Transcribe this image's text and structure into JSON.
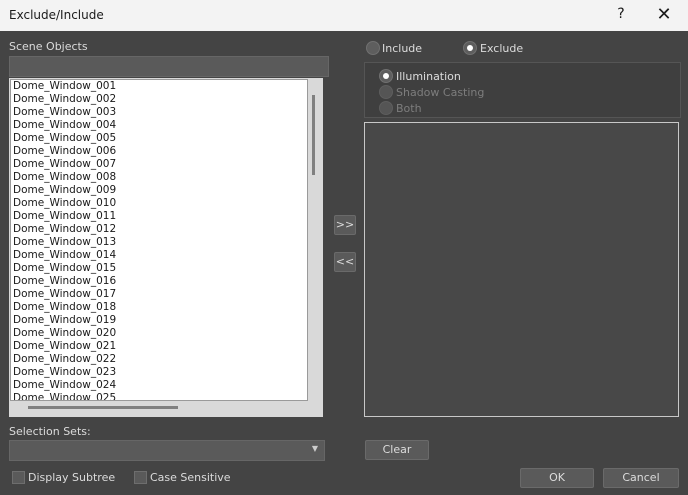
{
  "window": {
    "title": "Exclude/Include",
    "help_glyph": "?",
    "close_glyph": "✕"
  },
  "left": {
    "scene_objects_label": "Scene Objects",
    "search_value": "",
    "objects": [
      "Dome_Window_001",
      "Dome_Window_002",
      "Dome_Window_003",
      "Dome_Window_004",
      "Dome_Window_005",
      "Dome_Window_006",
      "Dome_Window_007",
      "Dome_Window_008",
      "Dome_Window_009",
      "Dome_Window_010",
      "Dome_Window_011",
      "Dome_Window_012",
      "Dome_Window_013",
      "Dome_Window_014",
      "Dome_Window_015",
      "Dome_Window_016",
      "Dome_Window_017",
      "Dome_Window_018",
      "Dome_Window_019",
      "Dome_Window_020",
      "Dome_Window_021",
      "Dome_Window_022",
      "Dome_Window_023",
      "Dome_Window_024",
      "Dome_Window_025"
    ],
    "selection_sets_label": "Selection Sets:",
    "selection_sets_value": "",
    "display_subtree_label": "Display Subtree",
    "case_sensitive_label": "Case Sensitive"
  },
  "middle": {
    "add_label": ">>",
    "remove_label": "<<"
  },
  "right": {
    "include_label": "Include",
    "exclude_label": "Exclude",
    "mode_selected": "Exclude",
    "illumination_label": "Illumination",
    "shadow_casting_label": "Shadow Casting",
    "both_label": "Both",
    "type_selected": "Illumination",
    "clear_label": "Clear"
  },
  "footer": {
    "ok_label": "OK",
    "cancel_label": "Cancel"
  },
  "icons": {
    "dropdown": "chevron-down-icon"
  }
}
